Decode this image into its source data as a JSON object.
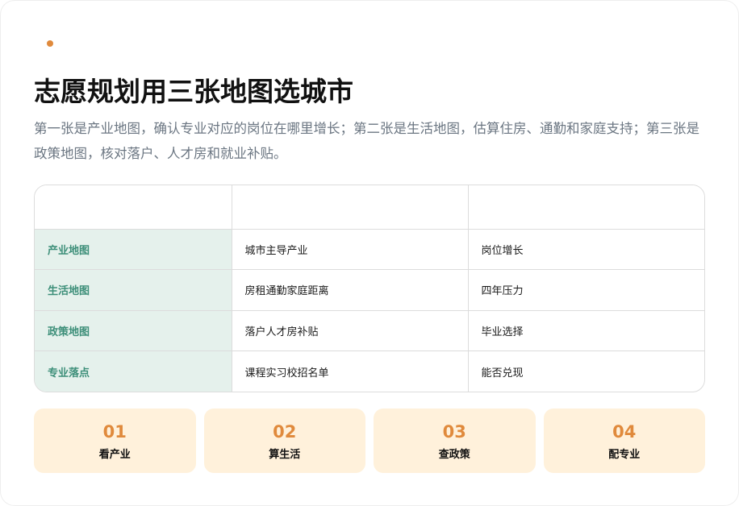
{
  "colors": {
    "accent": "#e08a3c",
    "row_header_bg": "#e5f1ec",
    "row_header_text": "#3d8f79",
    "step_bg": "#fff1db",
    "step_number": "#e08a3c"
  },
  "header": {
    "title": "志愿规划用三张地图选城市",
    "subtitle": "第一张是产业地图，确认专业对应的岗位在哪里增长；第二张是生活地图，估算住房、通勤和家庭支持；第三张是政策地图，核对落户、人才房和就业补贴。"
  },
  "table": {
    "columns": [
      "",
      "",
      ""
    ],
    "rows": [
      {
        "label": "产业地图",
        "cells": [
          "城市主导产业",
          "岗位增长"
        ]
      },
      {
        "label": "生活地图",
        "cells": [
          "房租通勤家庭距离",
          "四年压力"
        ]
      },
      {
        "label": "政策地图",
        "cells": [
          "落户人才房补贴",
          "毕业选择"
        ]
      },
      {
        "label": "专业落点",
        "cells": [
          "课程实习校招名单",
          "能否兑现"
        ]
      }
    ]
  },
  "steps": [
    {
      "number": "01",
      "label": "看产业"
    },
    {
      "number": "02",
      "label": "算生活"
    },
    {
      "number": "03",
      "label": "查政策"
    },
    {
      "number": "04",
      "label": "配专业"
    }
  ]
}
